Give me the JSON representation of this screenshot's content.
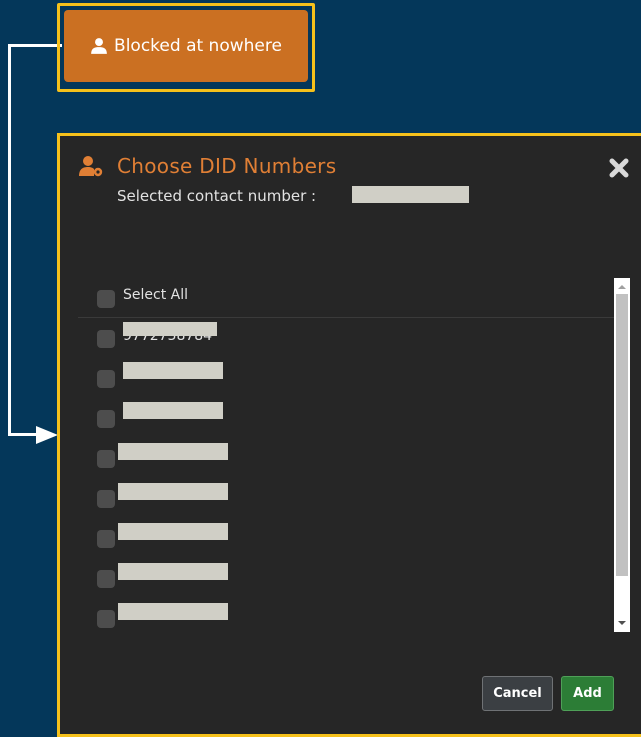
{
  "top_button": {
    "label": "Blocked at nowhere",
    "icon": "user-icon",
    "color": "#cb7022"
  },
  "modal": {
    "title": "Choose DID Numbers",
    "title_icon": "user-settings-icon",
    "subtitle_label": "Selected contact number :",
    "subtitle_value": "",
    "select_all_label": "Select All",
    "numbers": [
      {
        "value": "9772738784"
      },
      {
        "value": ""
      },
      {
        "value": ""
      },
      {
        "value": ""
      },
      {
        "value": ""
      },
      {
        "value": ""
      },
      {
        "value": ""
      },
      {
        "value": ""
      }
    ],
    "cancel_label": "Cancel",
    "add_label": "Add"
  },
  "colors": {
    "background": "#04375a",
    "highlight": "#f6c11b",
    "modal_bg": "#262626",
    "title": "#e07f35",
    "add": "#2c7d36"
  }
}
